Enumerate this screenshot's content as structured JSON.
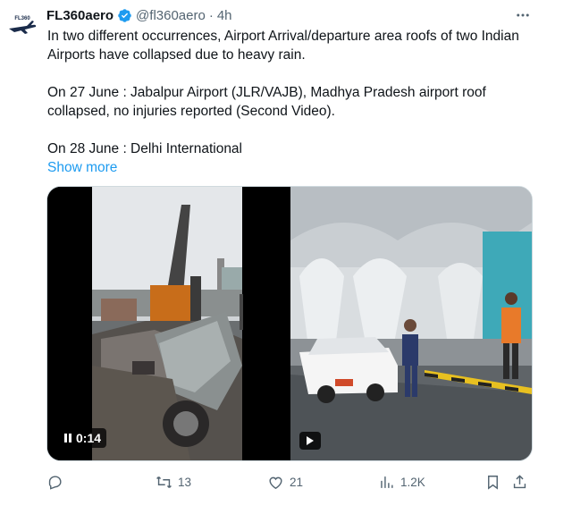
{
  "tweet": {
    "author_name": "FL360aero",
    "avatar_text": "FL360",
    "handle": "@fl360aero",
    "dot": "·",
    "time": "4h",
    "paragraphs": [
      "In two different occurrences, Airport Arrival/departure area roofs of two Indian Airports have collapsed due to heavy rain.",
      "On 27 June : Jabalpur Airport (JLR/VAJB), Madhya Pradesh airport roof collapsed, no injuries reported (Second Video).",
      "On 28 June : Delhi International"
    ],
    "show_more": "Show more"
  },
  "media": {
    "video1_time": "0:14"
  },
  "actions": {
    "replies": "",
    "reposts": "13",
    "likes": "21",
    "views": "1.2K"
  },
  "colors": {
    "accent": "#1d9bf0",
    "text": "#0f1419",
    "muted": "#536471"
  }
}
